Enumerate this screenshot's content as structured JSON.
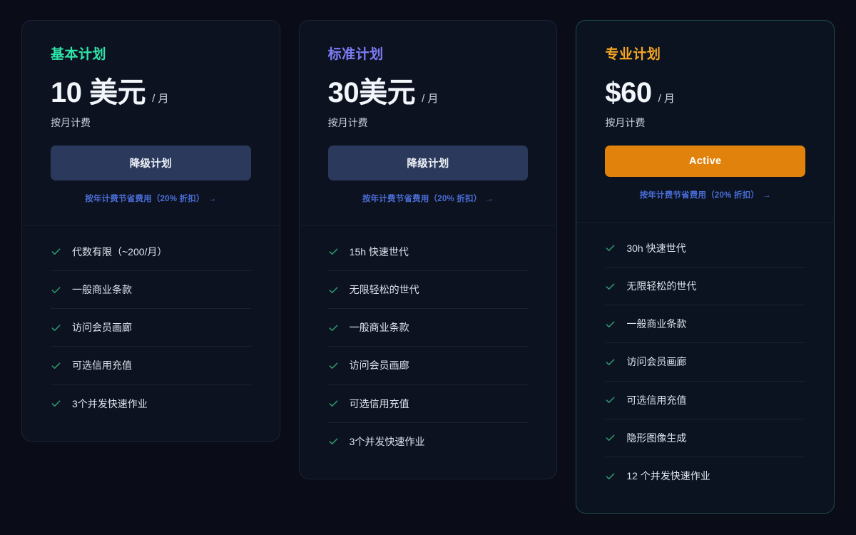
{
  "theme": {
    "page_background": "#0a0d17",
    "card_background": "#0d1220",
    "card_border": "#1c2338",
    "active_card_border": "#1f4a4c",
    "check_color": "#2e9e72",
    "link_color": "#4a6ed8",
    "secondary_button": "#2b3a5c",
    "active_button": "#e1820c"
  },
  "plans": [
    {
      "name": "基本计划",
      "name_color": "#2ee6a8",
      "price": "10 美元",
      "period": "/ 月",
      "billing_note": "按月计费",
      "button_label": "降级计划",
      "button_style": "secondary",
      "annual_link": "按年计费节省费用（20% 折扣）",
      "annual_arrow": "→",
      "features": [
        "代数有限（~200/月）",
        "一般商业条款",
        "访问会员画廊",
        "可选信用充值",
        "3个并发快速作业"
      ]
    },
    {
      "name": "标准计划",
      "name_color": "#7c7cf5",
      "price": "30美元",
      "period": "/ 月",
      "billing_note": "按月计费",
      "button_label": "降级计划",
      "button_style": "secondary",
      "annual_link": "按年计费节省费用（20% 折扣）",
      "annual_arrow": "→",
      "features": [
        "15h 快速世代",
        "无限轻松的世代",
        "一般商业条款",
        "访问会员画廊",
        "可选信用充值",
        "3个并发快速作业"
      ]
    },
    {
      "name": "专业计划",
      "name_color": "#f5a623",
      "price": "$60",
      "period": "/ 月",
      "billing_note": "按月计费",
      "button_label": "Active",
      "button_style": "active",
      "annual_link": "按年计费节省费用（20% 折扣）",
      "annual_arrow": "→",
      "features": [
        "30h 快速世代",
        "无限轻松的世代",
        "一般商业条款",
        "访问会员画廊",
        "可选信用充值",
        "隐形图像生成",
        "12 个并发快速作业"
      ]
    }
  ]
}
